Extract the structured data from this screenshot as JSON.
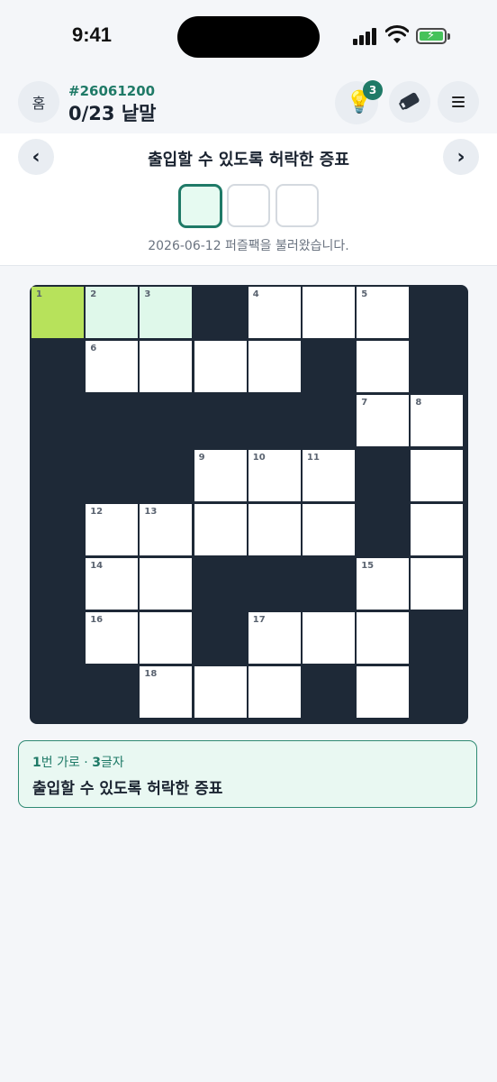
{
  "status_bar": {
    "time": "9:41"
  },
  "header": {
    "home_label": "홈",
    "puzzle_id": "#26061200",
    "word_progress": "0/23 낱말",
    "hint_count": "3",
    "icons": {
      "hint": "lightbulb-icon",
      "erase": "eraser-icon",
      "menu": "menu-icon"
    }
  },
  "clue_nav": {
    "prev_label": "‹",
    "next_label": "›",
    "title": "출입할 수 있도록 허락한 증표",
    "answer_length": 3,
    "loaded_message": "2026-06-12 퍼즐팩을 불러왔습니다."
  },
  "grid": {
    "rows": 8,
    "cols": 8,
    "cells": [
      [
        "1",
        "2",
        "3",
        "#",
        "4",
        "",
        "5",
        "#"
      ],
      [
        "#",
        "6",
        "",
        "",
        "",
        "#",
        "",
        "#"
      ],
      [
        "#",
        "#",
        "#",
        "#",
        "#",
        "#",
        "7",
        "8"
      ],
      [
        "#",
        "#",
        "#",
        "9",
        "10",
        "11",
        "#",
        ""
      ],
      [
        "#",
        "12",
        "13",
        "",
        "",
        "",
        "#",
        ""
      ],
      [
        "#",
        "14",
        "",
        "#",
        "#",
        "#",
        "15",
        ""
      ],
      [
        "#",
        "16",
        "",
        "#",
        "17",
        "",
        "",
        "#"
      ],
      [
        "#",
        "#",
        "18",
        "",
        "",
        "#",
        "",
        "#"
      ]
    ],
    "selected": [
      0,
      0
    ],
    "highlighted": [
      [
        0,
        0
      ],
      [
        0,
        1
      ],
      [
        0,
        2
      ]
    ]
  },
  "current_clue": {
    "number": "1",
    "direction": "번 가로 · ",
    "length": "3",
    "length_suffix": "글자",
    "text": "출입할 수 있도록 허락한 증표"
  },
  "colors": {
    "accent": "#1f7a67",
    "selected_cell": "#b7e25b",
    "highlight_cell": "#dff8ea",
    "block": "#1e2937"
  }
}
